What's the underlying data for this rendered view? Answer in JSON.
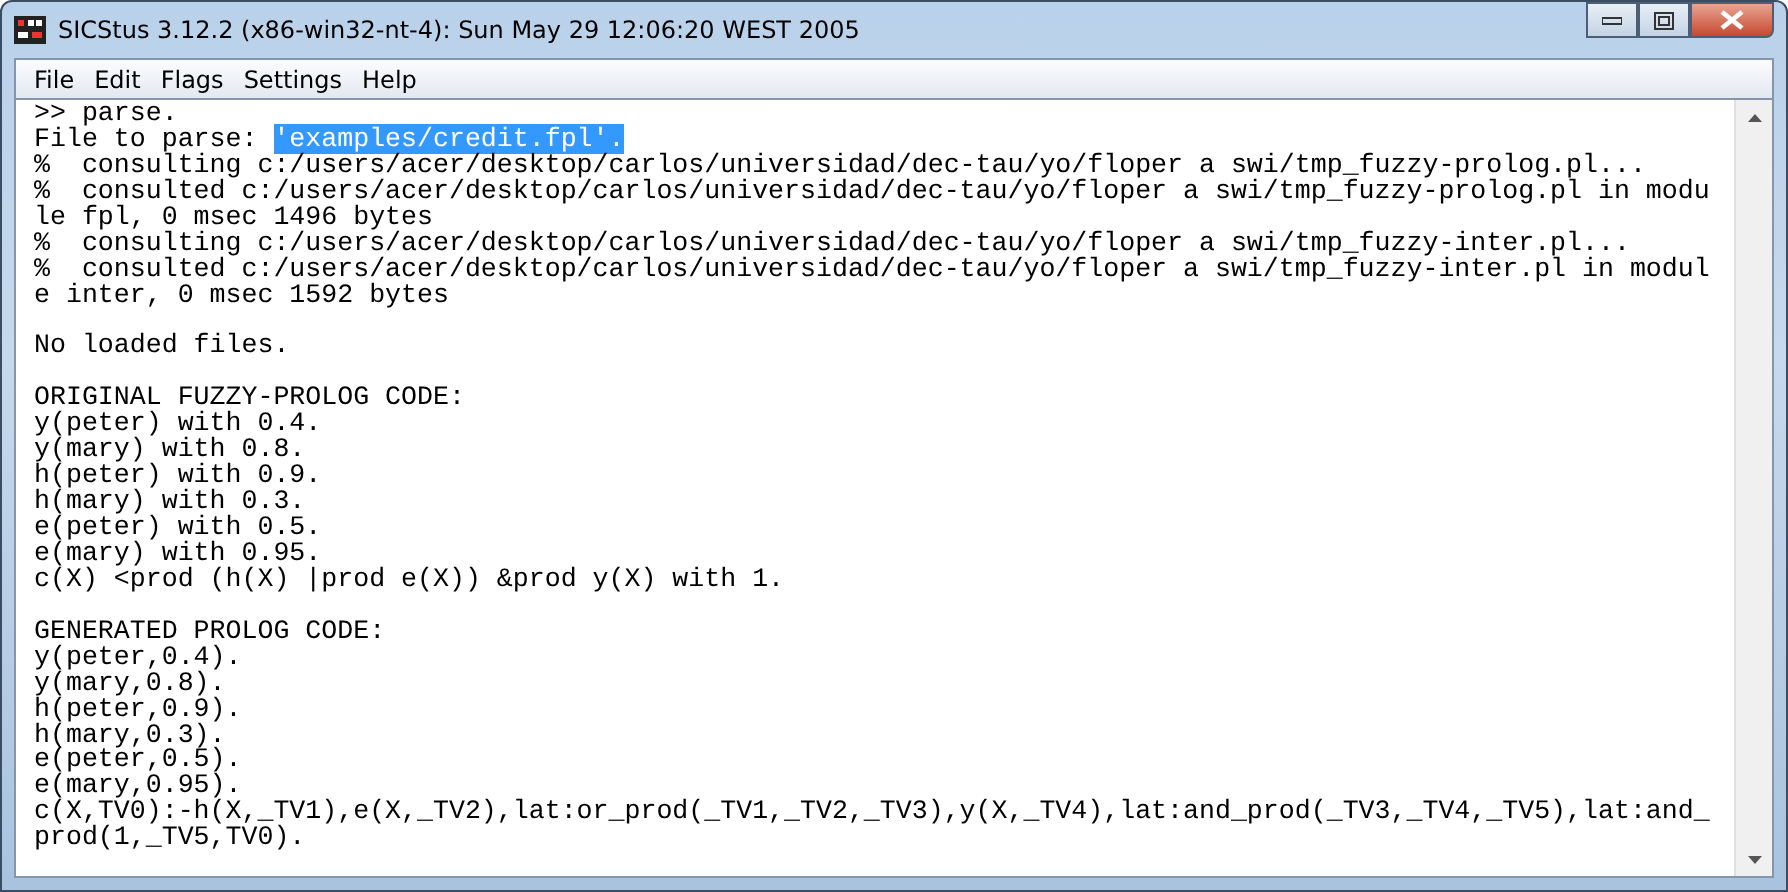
{
  "window": {
    "title": "SICStus 3.12.2 (x86-win32-nt-4): Sun May 29 12:06:20 WEST 2005"
  },
  "menu": [
    "File",
    "Edit",
    "Flags",
    "Settings",
    "Help"
  ],
  "console": {
    "lines": [
      {
        "kind": "text",
        "text": ">> parse."
      },
      {
        "kind": "selection",
        "text": "File to parse: ",
        "selection": "'examples/credit.fpl'."
      },
      {
        "kind": "text",
        "text": "%  consulting c:/users/acer/desktop/carlos/universidad/dec-tau/yo/floper a swi/tmp_fuzzy-prolog.pl..."
      },
      {
        "kind": "text",
        "text": "%  consulted c:/users/acer/desktop/carlos/universidad/dec-tau/yo/floper a swi/tmp_fuzzy-prolog.pl in modu"
      },
      {
        "kind": "text",
        "text": "le fpl, 0 msec 1496 bytes"
      },
      {
        "kind": "text",
        "text": "%  consulting c:/users/acer/desktop/carlos/universidad/dec-tau/yo/floper a swi/tmp_fuzzy-inter.pl..."
      },
      {
        "kind": "text",
        "text": "%  consulted c:/users/acer/desktop/carlos/universidad/dec-tau/yo/floper a swi/tmp_fuzzy-inter.pl in modul"
      },
      {
        "kind": "text",
        "text": "e inter, 0 msec 1592 bytes"
      },
      {
        "kind": "blank"
      },
      {
        "kind": "text",
        "text": "No loaded files."
      },
      {
        "kind": "blank"
      },
      {
        "kind": "text",
        "text": "ORIGINAL FUZZY-PROLOG CODE:"
      },
      {
        "kind": "text",
        "text": "y(peter) with 0.4."
      },
      {
        "kind": "text",
        "text": "y(mary) with 0.8."
      },
      {
        "kind": "text",
        "text": "h(peter) with 0.9."
      },
      {
        "kind": "text",
        "text": "h(mary) with 0.3."
      },
      {
        "kind": "text",
        "text": "e(peter) with 0.5."
      },
      {
        "kind": "text",
        "text": "e(mary) with 0.95."
      },
      {
        "kind": "text",
        "text": "c(X) <prod (h(X) |prod e(X)) &prod y(X) with 1."
      },
      {
        "kind": "blank"
      },
      {
        "kind": "text",
        "text": "GENERATED PROLOG CODE:"
      },
      {
        "kind": "text",
        "text": "y(peter,0.4)."
      },
      {
        "kind": "text",
        "text": "y(mary,0.8)."
      },
      {
        "kind": "text",
        "text": "h(peter,0.9)."
      },
      {
        "kind": "text",
        "text": "h(mary,0.3)."
      },
      {
        "kind": "text",
        "text": "e(peter,0.5)."
      },
      {
        "kind": "text",
        "text": "e(mary,0.95)."
      },
      {
        "kind": "text",
        "text": "c(X,TV0):-h(X,_TV1),e(X,_TV2),lat:or_prod(_TV1,_TV2,_TV3),y(X,_TV4),lat:and_prod(_TV3,_TV4,_TV5),lat:and_"
      },
      {
        "kind": "text",
        "text": "prod(1,_TV5,TV0)."
      }
    ]
  }
}
